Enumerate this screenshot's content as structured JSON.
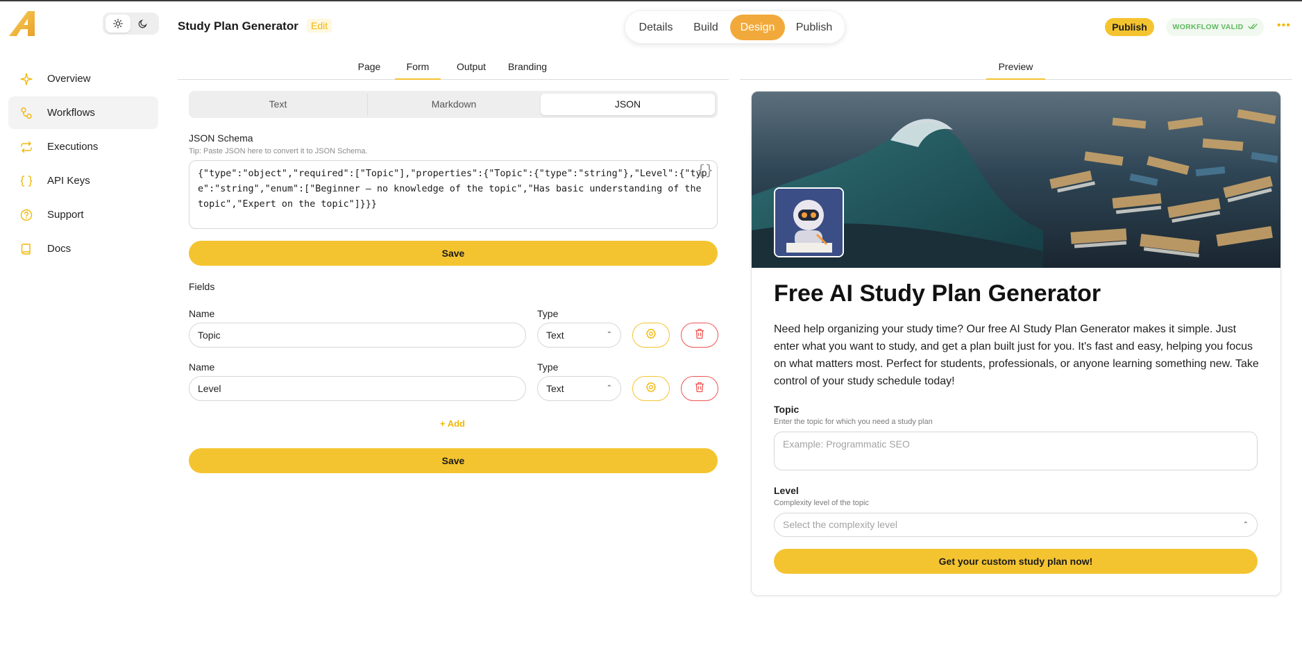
{
  "app": {
    "title": "Study Plan Generator",
    "edit_label": "Edit"
  },
  "sidebar": {
    "items": [
      {
        "label": "Overview",
        "icon": "sparkle-icon"
      },
      {
        "label": "Workflows",
        "icon": "workflow-icon",
        "active": true
      },
      {
        "label": "Executions",
        "icon": "repeat-icon"
      },
      {
        "label": "API Keys",
        "icon": "braces-icon"
      },
      {
        "label": "Support",
        "icon": "help-circle-icon"
      },
      {
        "label": "Docs",
        "icon": "book-icon"
      }
    ]
  },
  "stepper": {
    "steps": [
      "Details",
      "Build",
      "Design",
      "Publish"
    ],
    "active": "Design"
  },
  "header": {
    "publish_label": "Publish",
    "status_label": "WORKFLOW VALID"
  },
  "tabs": {
    "left": [
      "Page",
      "Form",
      "Output",
      "Branding"
    ],
    "left_active": "Form",
    "right": [
      "Preview"
    ]
  },
  "format": {
    "options": [
      "Text",
      "Markdown",
      "JSON"
    ],
    "selected": "JSON"
  },
  "schema": {
    "label": "JSON Schema",
    "tip": "Tip: Paste JSON here to convert it to JSON Schema.",
    "value": "{\"type\":\"object\",\"required\":[\"Topic\"],\"properties\":{\"Topic\":{\"type\":\"string\"},\"Level\":{\"type\":\"string\",\"enum\":[\"Beginner – no knowledge of the topic\",\"Has basic understanding of the topic\",\"Expert on the topic\"]}}}",
    "save_label": "Save"
  },
  "fields": {
    "heading": "Fields",
    "name_label": "Name",
    "type_label": "Type",
    "rows": [
      {
        "name": "Topic",
        "type": "Text"
      },
      {
        "name": "Level",
        "type": "Text"
      }
    ],
    "add_label": "+ Add",
    "save_label": "Save"
  },
  "preview": {
    "title": "Free AI Study Plan Generator",
    "description": "Need help organizing your study time? Our free AI Study Plan Generator makes it simple. Just enter what you want to study, and get a plan built just for you. It's fast and easy, helping you focus on what matters most. Perfect for students, professionals, or anyone learning something new. Take control of your study schedule today!",
    "topic_label": "Topic",
    "topic_help": "Enter the topic for which you need a study plan",
    "topic_placeholder": "Example: Programmatic SEO",
    "level_label": "Level",
    "level_help": "Complexity level of the topic",
    "level_placeholder": "Select the complexity level",
    "cta_label": "Get your custom study plan now!"
  },
  "colors": {
    "accent": "#f4c430",
    "step_active": "#f2a93b",
    "danger": "#ef5350",
    "valid": "#5fb85f"
  }
}
